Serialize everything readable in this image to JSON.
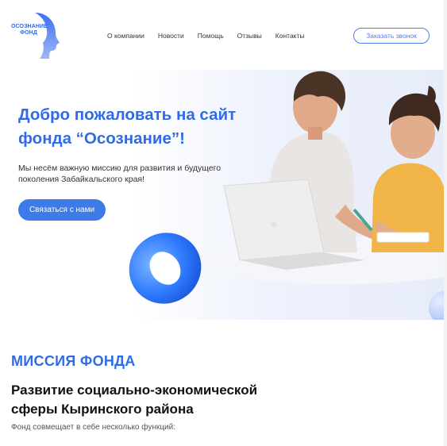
{
  "logo": {
    "line1": "ОСОЗНАНИЕ",
    "line2": "ФОНД"
  },
  "nav": {
    "items": [
      {
        "label": "О компании"
      },
      {
        "label": "Новости"
      },
      {
        "label": "Помощь"
      },
      {
        "label": "Отзывы"
      },
      {
        "label": "Контакты"
      }
    ],
    "call_button": "Заказать звонок"
  },
  "hero": {
    "title": "Добро пожаловать на сайт фонда “Осознание”!",
    "description": "Мы несём важную миссию для развития и будущего поколения Забайкальского края!",
    "button": "Связаться с нами"
  },
  "mission": {
    "label": "МИССИЯ ФОНДА",
    "title": "Развитие социально-экономической сферы Кыринского района",
    "text": "Фонд совмещает в себе несколько функций:"
  },
  "colors": {
    "accent": "#2f6be8",
    "button": "#3e7ae8"
  }
}
